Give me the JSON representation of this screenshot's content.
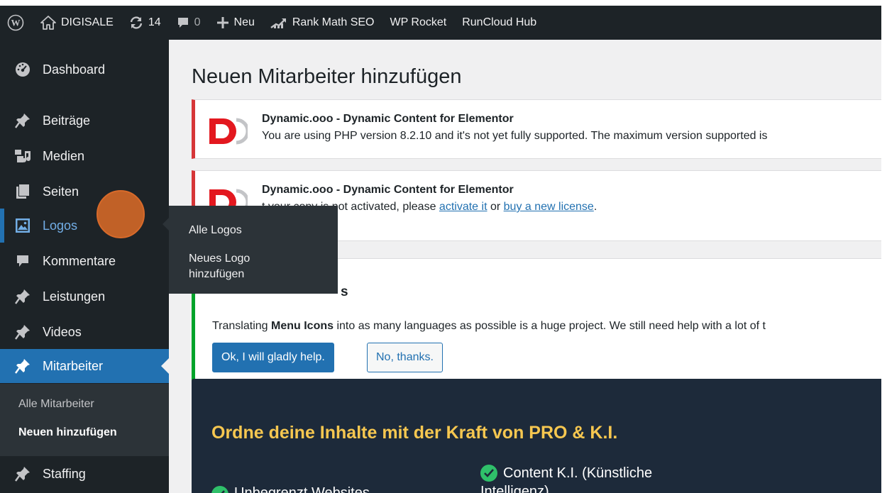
{
  "adminbar": {
    "site_name": "DIGISALE",
    "updates_count": "14",
    "comments_count": "0",
    "new_label": "Neu",
    "rankmath_label": "Rank Math SEO",
    "wprocket_label": "WP Rocket",
    "runcloud_label": "RunCloud Hub"
  },
  "sidebar": {
    "items": [
      {
        "label": "Dashboard",
        "icon": "dashboard-icon"
      },
      {
        "label": "Beiträge",
        "icon": "pin-icon"
      },
      {
        "label": "Medien",
        "icon": "media-icon"
      },
      {
        "label": "Seiten",
        "icon": "pages-icon"
      },
      {
        "label": "Logos",
        "icon": "image-icon"
      },
      {
        "label": "Kommentare",
        "icon": "comment-icon"
      },
      {
        "label": "Leistungen",
        "icon": "pin-icon"
      },
      {
        "label": "Videos",
        "icon": "pin-icon"
      },
      {
        "label": "Mitarbeiter",
        "icon": "pin-icon"
      },
      {
        "label": "Staffing",
        "icon": "pin-icon"
      }
    ],
    "submenu": [
      "Alle Mitarbeiter",
      "Neuen hinzufügen"
    ]
  },
  "flyout": {
    "items": [
      "Alle Logos",
      "Neues Logo hinzufügen"
    ],
    "item2_line1": "Neues Logo",
    "item2_line2": "hinzufügen"
  },
  "main": {
    "title": "Neuen Mitarbeiter hinzufügen",
    "notice1": {
      "title": "Dynamic.ooo - Dynamic Content for Elementor",
      "message": "You are using PHP version 8.2.10 and it's not yet fully supported. The maximum version supported is"
    },
    "notice2": {
      "title": "Dynamic.ooo - Dynamic Content for Elementor",
      "message_pre": "t your copy is not activated, please ",
      "link1": "activate it",
      "message_mid": " or ",
      "link2": "buy a new license",
      "message_post": "."
    },
    "notice3": {
      "heading_fragment": "s",
      "message_pre": "Translating ",
      "message_bold": "Menu Icons",
      "message_post": " into as many languages as possible is a huge project. We still need help with a lot of t",
      "btn_primary": "Ok, I will gladly help.",
      "btn_secondary": "No, thanks."
    },
    "promo": {
      "heading": "Ordne deine Inhalte mit der Kraft von PRO & K.I.",
      "feature1": "Unbegrenzt Websites",
      "feature2_line1": "Content K.I. (Künstliche",
      "feature2_line2": "Intelligenz)"
    }
  },
  "colors": {
    "adminbar_bg": "#1d2327",
    "accent": "#2271b1",
    "error_border": "#d63638",
    "success_border": "#00a32a",
    "promo_bg": "#1d2a3a",
    "promo_heading": "#f6c750",
    "cursor": "#de6c28"
  }
}
